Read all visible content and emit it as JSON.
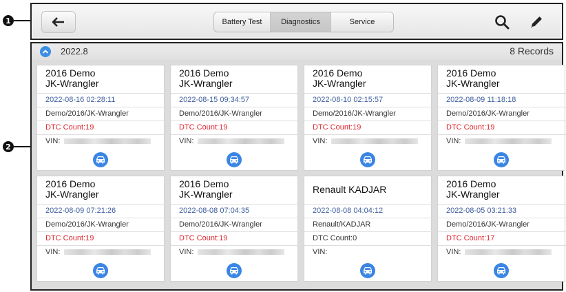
{
  "callouts": {
    "toolbar": "1",
    "content": "2"
  },
  "toolbar": {
    "tabs": [
      {
        "label": "Battery Test",
        "active": false
      },
      {
        "label": "Diagnostics",
        "active": true
      },
      {
        "label": "Service",
        "active": false
      }
    ],
    "icons": [
      "back-arrow-icon",
      "search-icon",
      "edit-icon"
    ]
  },
  "group": {
    "date": "2022.8",
    "count": "8 Records"
  },
  "cards": [
    {
      "title": "2016 Demo\nJK-Wrangler",
      "date": "2022-08-16 02:28:11",
      "path": "Demo/2016/JK-Wrangler",
      "dtc": "DTC Count:19",
      "vin_label": "VIN:"
    },
    {
      "title": "2016 Demo\nJK-Wrangler",
      "date": "2022-08-15 09:34:57",
      "path": "Demo/2016/JK-Wrangler",
      "dtc": "DTC Count:19",
      "vin_label": "VIN:"
    },
    {
      "title": "2016 Demo\nJK-Wrangler",
      "date": "2022-08-10 02:15:57",
      "path": "Demo/2016/JK-Wrangler",
      "dtc": "DTC Count:19",
      "vin_label": "VIN:"
    },
    {
      "title": "2016 Demo\nJK-Wrangler",
      "date": "2022-08-09 11:18:18",
      "path": "Demo/2016/JK-Wrangler",
      "dtc": "DTC Count:19",
      "vin_label": "VIN:"
    },
    {
      "title": "2016 Demo\nJK-Wrangler",
      "date": "2022-08-09 07:21:26",
      "path": "Demo/2016/JK-Wrangler",
      "dtc": "DTC Count:19",
      "vin_label": "VIN:"
    },
    {
      "title": "2016 Demo\nJK-Wrangler",
      "date": "2022-08-08 07:04:35",
      "path": "Demo/2016/JK-Wrangler",
      "dtc": "DTC Count:19",
      "vin_label": "VIN:"
    },
    {
      "title": "Renault KADJAR",
      "date": "2022-08-08 04:04:12",
      "path": "Renault/KADJAR",
      "dtc": "DTC Count:0",
      "vin_label": "VIN:"
    },
    {
      "title": "2016 Demo\nJK-Wrangler",
      "date": "2022-08-05 03:21:33",
      "path": "Demo/2016/JK-Wrangler",
      "dtc": "DTC Count:17",
      "vin_label": "VIN:"
    }
  ],
  "colors": {
    "accent": "#3b86e4",
    "dtc_alert": "#e0232b",
    "date_text": "#3f5f9e"
  }
}
